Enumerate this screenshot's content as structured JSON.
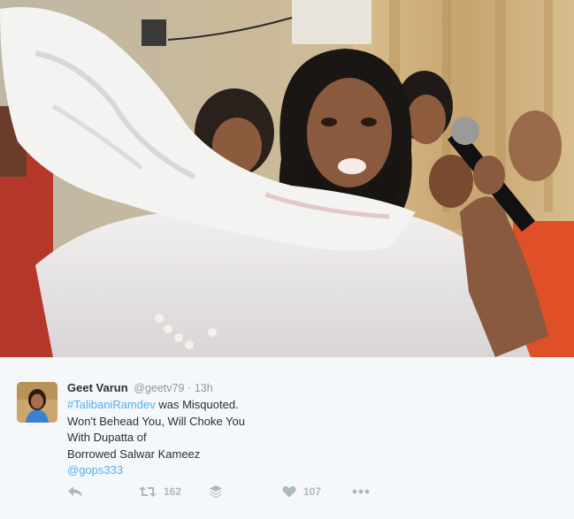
{
  "tweet": {
    "author_name": "Geet Varun",
    "handle": "@geetv79",
    "separator": "·",
    "time": "13h",
    "hashtag": "#TalibaniRamdev",
    "line1_rest": " was Misquoted.",
    "line2": "Won't Behead You, Will Choke You",
    "line3": "With Dupatta of",
    "line4": "Borrowed Salwar Kameez",
    "mention": "@gops333"
  },
  "actions": {
    "reply_icon": "reply-icon",
    "retweet_icon": "retweet-icon",
    "retweet_count": "162",
    "buffer_icon": "stack-icon",
    "like_icon": "heart-icon",
    "like_count": "107",
    "more_icon": "more-dots-icon"
  },
  "colors": {
    "link": "#55acee",
    "text": "#292f33",
    "muted": "#8899a6",
    "action": "#aab8c2",
    "background": "#f5f8fa"
  }
}
